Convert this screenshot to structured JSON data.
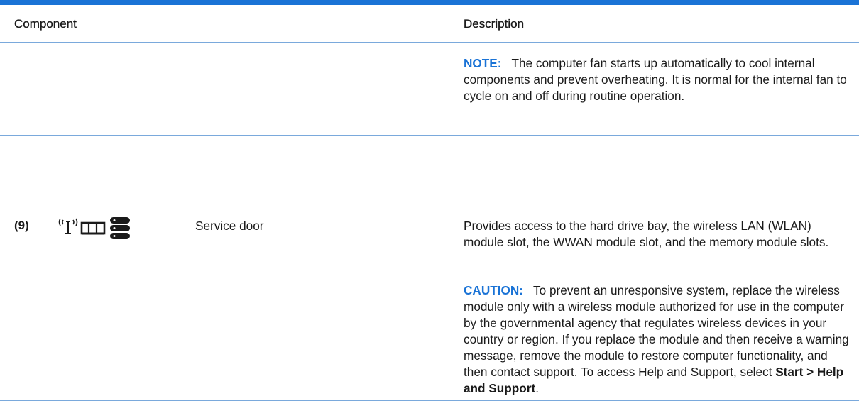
{
  "table": {
    "headers": {
      "component": "Component",
      "description": "Description"
    },
    "note": {
      "label": "NOTE:",
      "text": "The computer fan starts up automatically to cool internal components and prevent overheating. It is normal for the internal fan to cycle on and off during routine operation."
    },
    "row": {
      "number": "(9)",
      "icons": [
        "wireless-icon",
        "memory-module-icon",
        "hard-drive-icon"
      ],
      "name": "Service door",
      "description": "Provides access to the hard drive bay, the wireless LAN (WLAN) module slot, the WWAN module slot, and the memory module slots.",
      "caution": {
        "label": "CAUTION:",
        "text": "To prevent an unresponsive system, replace the wireless module only with a wireless module authorized for use in the computer by the governmental agency that regulates wireless devices in your country or region. If you replace the module and then receive a warning message, remove the module to restore computer functionality, and then contact support. To access Help and Support, select ",
        "path": "Start > Help and Support",
        "end": "."
      }
    }
  },
  "colors": {
    "accent": "#1a73d6",
    "rule": "#7aa9dc"
  }
}
